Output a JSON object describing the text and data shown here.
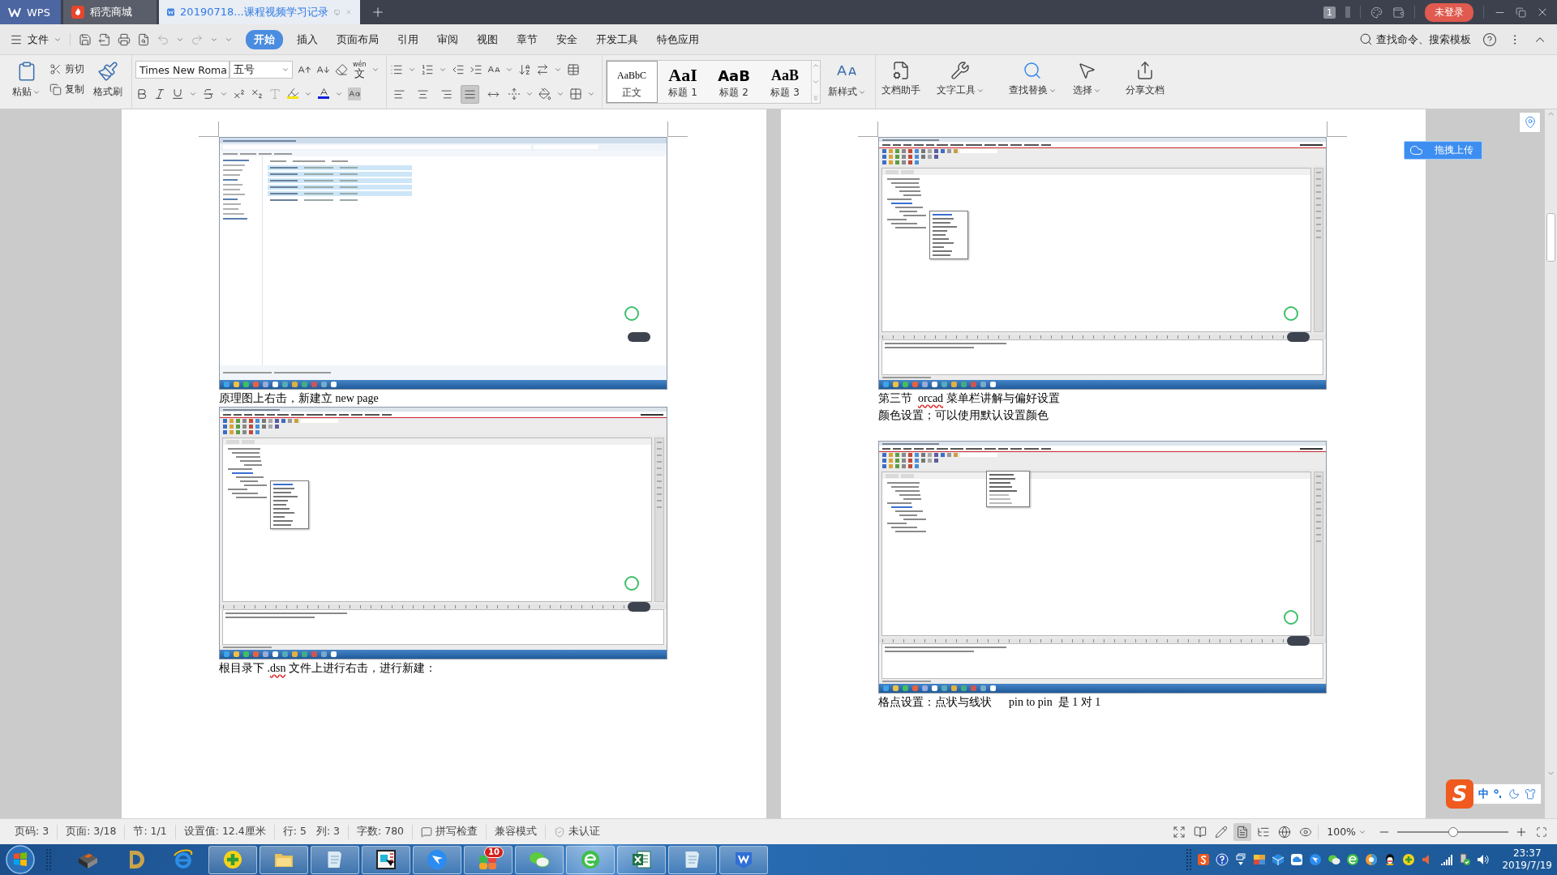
{
  "title_bar": {
    "tabs": [
      {
        "kind": "home",
        "label": "WPS",
        "selected": false
      },
      {
        "kind": "store",
        "label": "稻壳商城",
        "selected": false
      },
      {
        "kind": "document",
        "label": "20190718...课程视频学习记录",
        "selected": true
      }
    ],
    "window_count": "1",
    "login": "未登录"
  },
  "menu_bar": {
    "file": "文件",
    "tabs": [
      {
        "label": "开始",
        "selected": true
      },
      {
        "label": "插入",
        "selected": false
      },
      {
        "label": "页面布局",
        "selected": false
      },
      {
        "label": "引用",
        "selected": false
      },
      {
        "label": "审阅",
        "selected": false
      },
      {
        "label": "视图",
        "selected": false
      },
      {
        "label": "章节",
        "selected": false
      },
      {
        "label": "安全",
        "selected": false
      },
      {
        "label": "开发工具",
        "selected": false
      },
      {
        "label": "特色应用",
        "selected": false
      }
    ],
    "search": "查找命令、搜索模板"
  },
  "ribbon": {
    "clipboard": {
      "paste": "粘贴",
      "cut": "剪切",
      "copy": "复制",
      "format_painter": "格式刷"
    },
    "font": {
      "name": "Times New Roma",
      "size": "五号",
      "pinyin": "wén",
      "pinyin_char": "文"
    },
    "alignment": [
      {
        "kind": "left",
        "selected": false
      },
      {
        "kind": "center",
        "selected": false
      },
      {
        "kind": "right",
        "selected": false
      },
      {
        "kind": "justify",
        "selected": true
      },
      {
        "kind": "distributed",
        "selected": false
      }
    ],
    "styles": [
      {
        "kind": "body",
        "sample": "AaBbC",
        "label": "正文",
        "selected": true
      },
      {
        "kind": "heading1",
        "sample": "AaI",
        "label": "标题 1",
        "selected": false
      },
      {
        "kind": "heading2",
        "sample": "AaB",
        "label": "标题 2",
        "selected": false
      },
      {
        "kind": "heading3",
        "sample": "AaB",
        "label": "标题 3",
        "selected": false
      }
    ],
    "new_style": "新样式",
    "tools": [
      {
        "kind": "assistant",
        "label": "文档助手",
        "dropdown": false
      },
      {
        "kind": "text-tools",
        "label": "文字工具",
        "dropdown": true
      },
      {
        "kind": "find",
        "label": "查找替换",
        "dropdown": true
      },
      {
        "kind": "select",
        "label": "选择",
        "dropdown": true
      },
      {
        "kind": "share",
        "label": "分享文档",
        "dropdown": false
      }
    ]
  },
  "pages": [
    {
      "blocks": [
        {
          "kind": "explorer_screenshot"
        },
        {
          "kind": "caption",
          "segments": [
            {
              "text": "原理图上右击，新建立 new page",
              "spell_error": false
            }
          ]
        },
        {
          "kind": "context_menu_screenshot"
        },
        {
          "kind": "caption",
          "segments": [
            {
              "text": "根目录下 .",
              "spell_error": false
            },
            {
              "text": "dsn",
              "spell_error": true
            },
            {
              "text": " 文件上进行右击，进行新建：",
              "spell_error": false
            }
          ]
        }
      ]
    },
    {
      "blocks": [
        {
          "kind": "context_menu_screenshot"
        },
        {
          "kind": "caption",
          "segments": [
            {
              "text": "第三节  ",
              "spell_error": false
            },
            {
              "text": "orcad",
              "spell_error": true
            },
            {
              "text": " 菜单栏讲解与偏好设置",
              "spell_error": false
            }
          ]
        },
        {
          "kind": "caption",
          "segments": [
            {
              "text": "颜色设置；可以使用默认设置颜色",
              "spell_error": false
            }
          ]
        },
        {
          "kind": "blank_line"
        },
        {
          "kind": "dropdown_screenshot"
        },
        {
          "kind": "caption",
          "segments": [
            {
              "text": "格点设置：点状与线状      pin to pin  是 1 对 1",
              "spell_error": false
            }
          ]
        }
      ]
    }
  ],
  "floating": {
    "upload": "拖拽上传",
    "ime_logo": "S",
    "ime_mode": "中"
  },
  "status_bar": {
    "items": [
      {
        "kind": "text",
        "labels": [
          "页码: 3"
        ]
      },
      {
        "kind": "text",
        "labels": [
          "页面: 3/18"
        ]
      },
      {
        "kind": "text",
        "labels": [
          "节: 1/1"
        ]
      },
      {
        "kind": "text",
        "labels": [
          "设置值: 12.4厘米"
        ]
      },
      {
        "kind": "text",
        "labels": [
          "行: 5",
          "列: 3"
        ]
      },
      {
        "kind": "text",
        "labels": [
          "字数: 780"
        ]
      },
      {
        "kind": "spell-check",
        "labels": [
          "拼写检查"
        ]
      },
      {
        "kind": "text",
        "labels": [
          "兼容模式"
        ]
      },
      {
        "kind": "certification",
        "labels": [
          "未认证"
        ]
      }
    ],
    "views": [
      {
        "kind": "fullscreen",
        "selected": false
      },
      {
        "kind": "reading",
        "selected": false
      },
      {
        "kind": "writing",
        "selected": false
      },
      {
        "kind": "page",
        "selected": true
      },
      {
        "kind": "outline",
        "selected": false
      },
      {
        "kind": "web",
        "selected": false
      },
      {
        "kind": "eye-care",
        "selected": false
      }
    ],
    "zoom": {
      "label": "100%",
      "level": 0.5
    }
  },
  "taskbar": {
    "apps": [
      {
        "kind": "book",
        "running": false
      },
      {
        "kind": "d-app",
        "running": false
      },
      {
        "kind": "ie",
        "running": false
      },
      {
        "kind": "plus-shield",
        "running": true
      },
      {
        "kind": "folder",
        "running": true
      },
      {
        "kind": "notepad",
        "running": true
      },
      {
        "kind": "schematic",
        "running": true
      },
      {
        "kind": "bird",
        "running": true
      },
      {
        "kind": "tiles",
        "running": true,
        "badge": "10"
      },
      {
        "kind": "chat",
        "running": true
      },
      {
        "kind": "e-browser",
        "running": true
      },
      {
        "kind": "sheet",
        "running": true
      },
      {
        "kind": "notepad",
        "running": true
      },
      {
        "kind": "writer",
        "running": true
      }
    ],
    "tray": [
      {
        "kind": "ime"
      },
      {
        "kind": "help"
      },
      {
        "kind": "window-switch"
      },
      {
        "kind": "keyboard"
      },
      {
        "kind": "cube"
      },
      {
        "kind": "cloud"
      },
      {
        "kind": "bird"
      },
      {
        "kind": "chat"
      },
      {
        "kind": "e-browser"
      },
      {
        "kind": "ball"
      },
      {
        "kind": "penguin"
      },
      {
        "kind": "plus-shield"
      },
      {
        "kind": "horn"
      },
      {
        "kind": "signal"
      },
      {
        "kind": "network"
      },
      {
        "kind": "volume"
      }
    ],
    "time": "23:37",
    "date": "2019/7/19"
  }
}
